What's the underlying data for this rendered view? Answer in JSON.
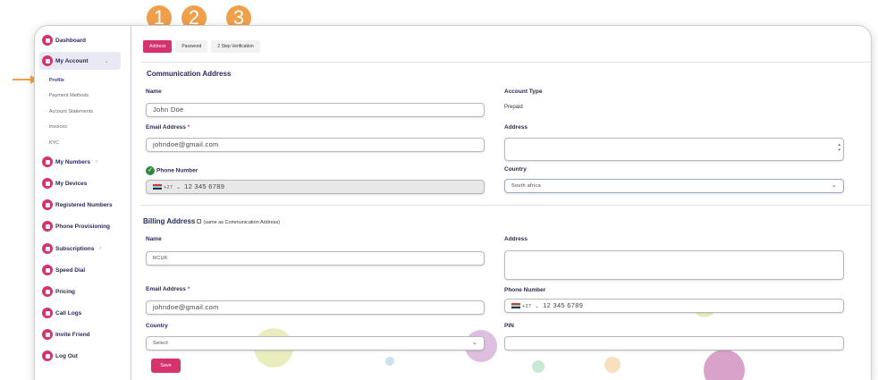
{
  "steps": [
    "1",
    "2",
    "3"
  ],
  "colors": {
    "accent": "#d4336d",
    "step": "#f0a04a",
    "nav_text": "#2a2a5a"
  },
  "sidebar": {
    "dashboard": "Dashboard",
    "my_account": "My Account",
    "sub_items": [
      "Profile",
      "Payment Methods",
      "Account Statements",
      "Invoices",
      "KYC"
    ],
    "my_numbers": "My Numbers",
    "my_devices": "My Devices",
    "registered_numbers": "Registered Numbers",
    "phone_provisioning": "Phone Provisioning",
    "subscriptions": "Subscriptions",
    "speed_dial": "Speed Dial",
    "pricing": "Pricing",
    "call_logs": "Call Logs",
    "invite_friend": "Invite Friend",
    "log_out": "Log Out"
  },
  "tabs": [
    "Address",
    "Password",
    "2 Step Verification"
  ],
  "communication": {
    "title": "Communication Address",
    "name_label": "Name",
    "name_value": "John Doe",
    "email_label": "Email Address",
    "email_value": "johndoe@gmail.com",
    "phone_label": "Phone Number",
    "phone_code": "+27",
    "phone_value": "12 345 6789",
    "account_type_label": "Account Type",
    "account_type_value": "Prepaid",
    "address_label": "Address",
    "country_label": "Country",
    "country_value": "South africa"
  },
  "billing": {
    "title": "Billing Address",
    "same_as": "(same as Communication Address)",
    "name_label": "Name",
    "name_value": "RCUK",
    "email_label": "Email Address",
    "email_value": "johndoe@gmail.com",
    "country_label": "Country",
    "country_placeholder": "Select",
    "address_label": "Address",
    "phone_label": "Phone Number",
    "phone_code": "+27",
    "phone_value": "12 345 6789",
    "pin_label": "PIN"
  },
  "save_label": "Save"
}
